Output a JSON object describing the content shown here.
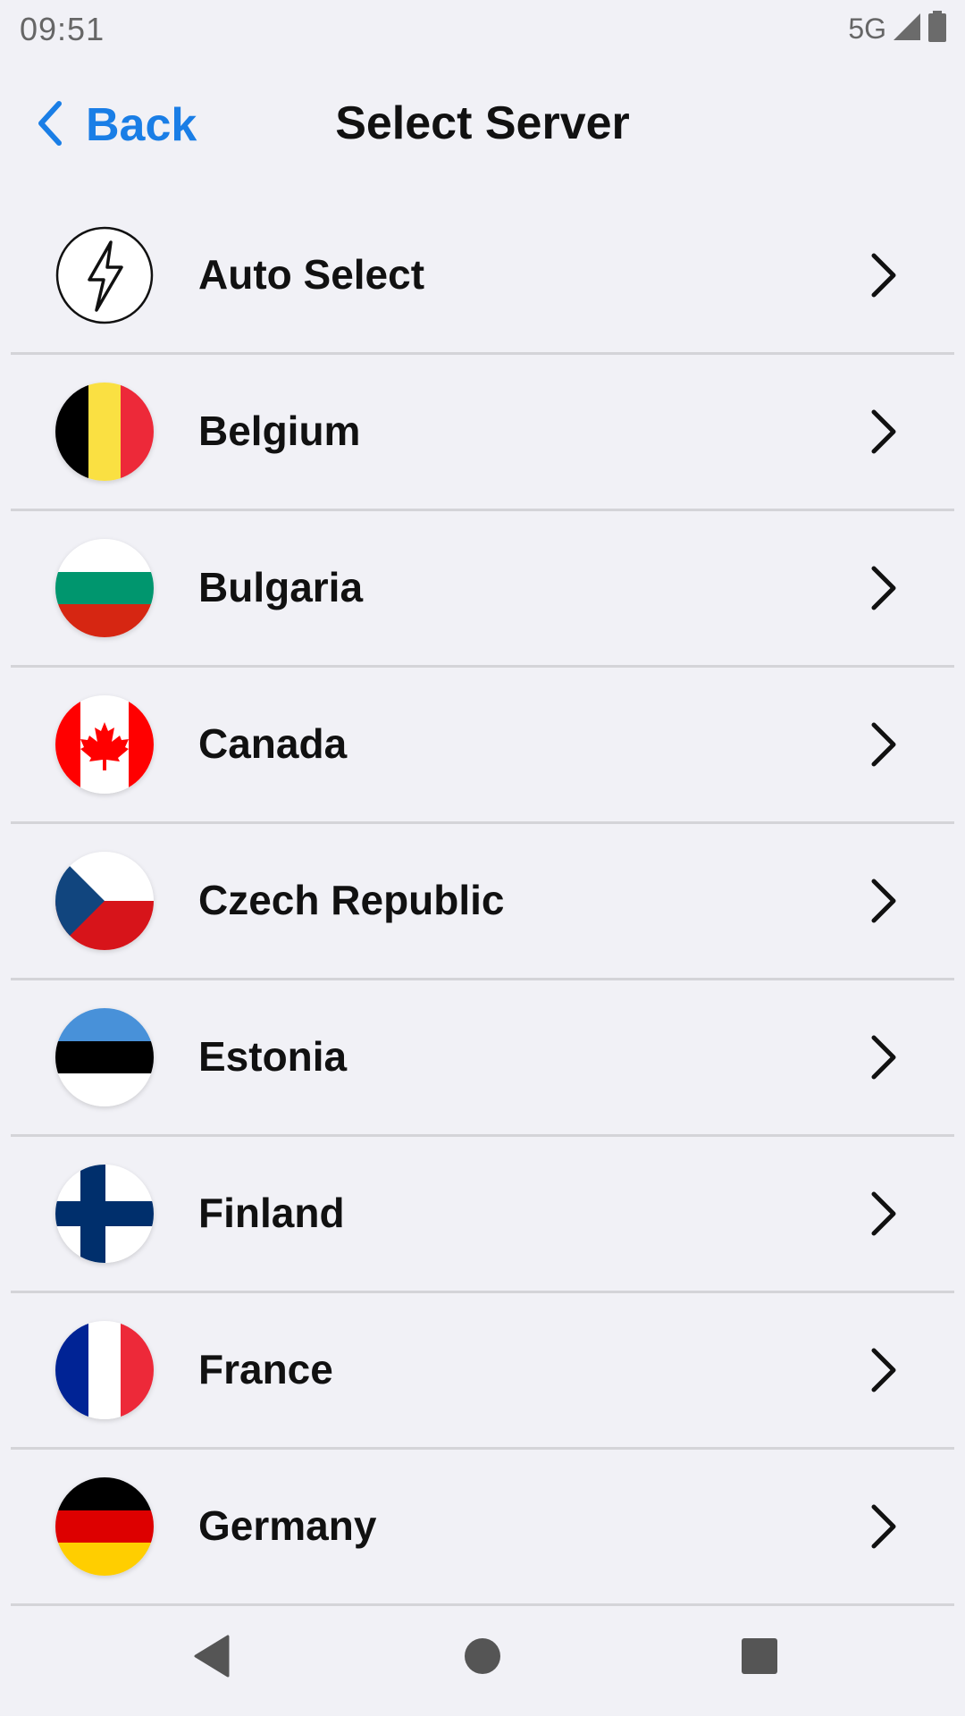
{
  "status_bar": {
    "time": "09:51",
    "network": "5G",
    "icons": [
      "signal-icon",
      "battery-icon"
    ]
  },
  "header": {
    "back_label": "Back",
    "title": "Select Server",
    "accent_color": "#1a7ee6"
  },
  "servers": [
    {
      "label": "Auto Select",
      "icon": "lightning-icon"
    },
    {
      "label": "Belgium",
      "icon": "belgium-flag-icon"
    },
    {
      "label": "Bulgaria",
      "icon": "bulgaria-flag-icon"
    },
    {
      "label": "Canada",
      "icon": "canada-flag-icon"
    },
    {
      "label": "Czech Republic",
      "icon": "czech-flag-icon"
    },
    {
      "label": "Estonia",
      "icon": "estonia-flag-icon"
    },
    {
      "label": "Finland",
      "icon": "finland-flag-icon"
    },
    {
      "label": "France",
      "icon": "france-flag-icon"
    },
    {
      "label": "Germany",
      "icon": "germany-flag-icon"
    }
  ],
  "nav_bar": {
    "icons": [
      "back-triangle-icon",
      "home-circle-icon",
      "recents-square-icon"
    ]
  }
}
